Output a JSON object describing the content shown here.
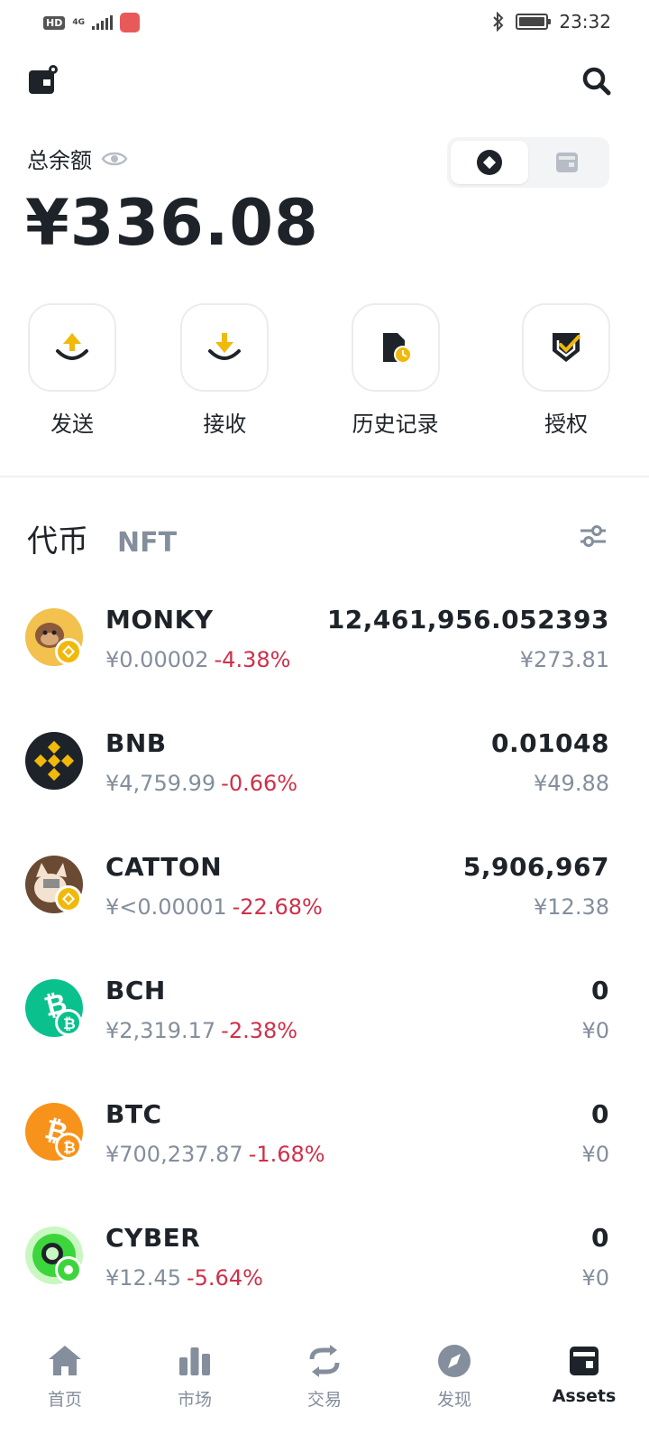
{
  "status_bar": {
    "hd": "HD",
    "network": "4G",
    "time": "23:32"
  },
  "balance": {
    "label": "总余额",
    "amount": "¥336.08"
  },
  "actions": [
    {
      "label": "发送",
      "icon": "send-icon"
    },
    {
      "label": "接收",
      "icon": "receive-icon"
    },
    {
      "label": "历史记录",
      "icon": "history-icon"
    },
    {
      "label": "授权",
      "icon": "authorize-icon"
    }
  ],
  "tabs": {
    "active": "代币",
    "other": "NFT"
  },
  "tokens": [
    {
      "symbol": "MONKY",
      "price": "¥0.00002",
      "change": "-4.38%",
      "amount": "12,461,956.052393",
      "value": "¥273.81"
    },
    {
      "symbol": "BNB",
      "price": "¥4,759.99",
      "change": "-0.66%",
      "amount": "0.01048",
      "value": "¥49.88"
    },
    {
      "symbol": "CATTON",
      "price": "¥<0.00001",
      "change": "-22.68%",
      "amount": "5,906,967",
      "value": "¥12.38"
    },
    {
      "symbol": "BCH",
      "price": "¥2,319.17",
      "change": "-2.38%",
      "amount": "0",
      "value": "¥0"
    },
    {
      "symbol": "BTC",
      "price": "¥700,237.87",
      "change": "-1.68%",
      "amount": "0",
      "value": "¥0"
    },
    {
      "symbol": "CYBER",
      "price": "¥12.45",
      "change": "-5.64%",
      "amount": "0",
      "value": "¥0"
    }
  ],
  "bottom_nav": [
    {
      "label": "首页",
      "icon": "home-icon"
    },
    {
      "label": "市场",
      "icon": "market-icon"
    },
    {
      "label": "交易",
      "icon": "trade-icon"
    },
    {
      "label": "发现",
      "icon": "discover-icon"
    },
    {
      "label": "Assets",
      "icon": "assets-icon",
      "active": true
    }
  ],
  "colors": {
    "accent": "#f0b90b",
    "negative": "#cf304a",
    "text_primary": "#1e2329",
    "text_secondary": "#848e9c"
  }
}
